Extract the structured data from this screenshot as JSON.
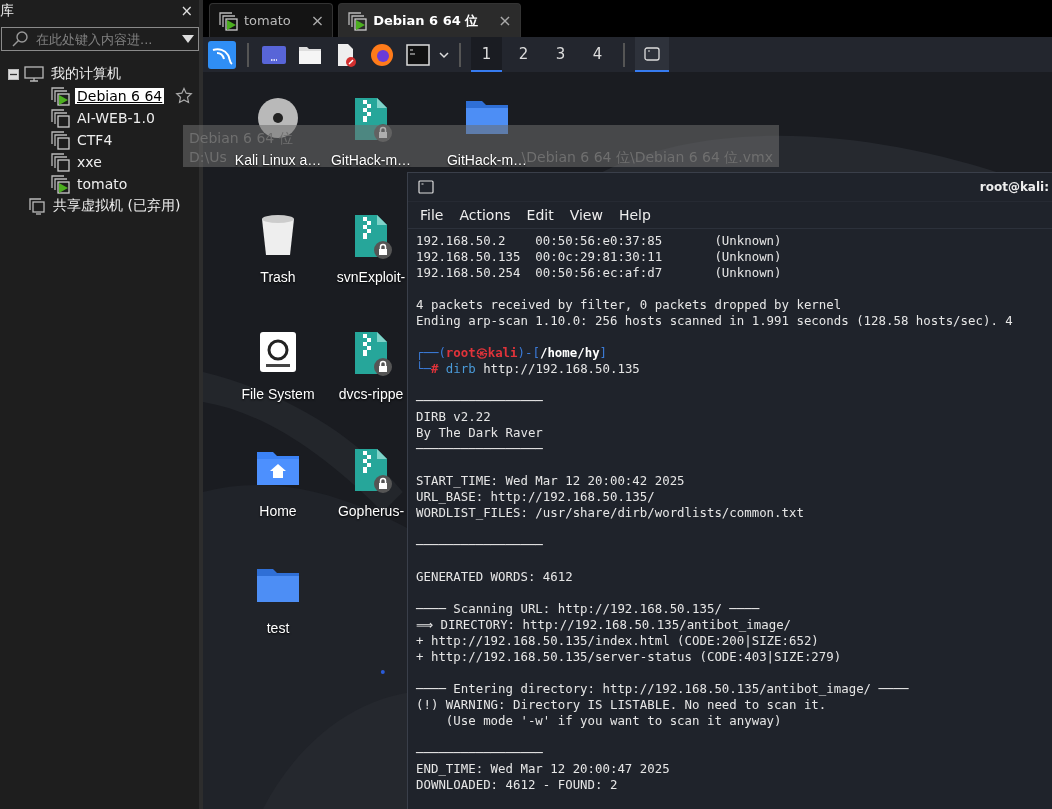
{
  "library": {
    "title": "库",
    "close": "×",
    "search": {
      "placeholder": "在此处键入内容进..."
    },
    "tree": [
      {
        "label": "我的计算机",
        "kind": "computer",
        "expanded": true,
        "children": [
          {
            "label": "Debian 6 64",
            "running": true,
            "selected": true
          },
          {
            "label": "AI-WEB-1.0",
            "running": false,
            "selected": false
          },
          {
            "label": "CTF4",
            "running": false,
            "selected": false
          },
          {
            "label": "xxe",
            "running": false,
            "selected": false
          },
          {
            "label": "tomato",
            "running": true,
            "selected": false
          }
        ]
      },
      {
        "label": "共享虚拟机 (已弃用)",
        "kind": "shared"
      }
    ]
  },
  "tabs": [
    {
      "label": "tomato",
      "close": "×",
      "selected": false
    },
    {
      "label": "Debian 6 64 位",
      "close": "×",
      "selected": true
    }
  ],
  "tooltip": {
    "title": "Debian 6 64 位",
    "path_parts": [
      "D:\\Us",
      "\\Debian 6 64 位\\Debian 6 64 位.vmx"
    ]
  },
  "panel": {
    "workspaces": [
      {
        "label": "1",
        "selected": true
      },
      {
        "label": "2",
        "selected": false
      },
      {
        "label": "3",
        "selected": false
      },
      {
        "label": "4",
        "selected": false
      }
    ]
  },
  "desktop_rows": [
    {
      "icons": [
        {
          "label": "Kali Linux a…",
          "kind": "disc"
        },
        {
          "label": "GitHack-m…",
          "kind": "archive"
        },
        {
          "label": "GitHack-m…",
          "kind": "folder"
        }
      ]
    },
    {
      "icons": [
        {
          "label": "Trash",
          "kind": "trash"
        },
        {
          "label": "svnExploit-",
          "kind": "archive"
        }
      ]
    },
    {
      "icons": [
        {
          "label": "File System",
          "kind": "drive"
        },
        {
          "label": "dvcs-rippe",
          "kind": "archive"
        }
      ]
    },
    {
      "icons": [
        {
          "label": "Home",
          "kind": "home"
        },
        {
          "label": "Gopherus-",
          "kind": "archive"
        }
      ]
    },
    {
      "icons": [
        {
          "label": "test",
          "kind": "folder"
        }
      ]
    }
  ],
  "terminal": {
    "title": "root@kali:",
    "menu": [
      "File",
      "Actions",
      "Edit",
      "View",
      "Help"
    ],
    "lines": [
      {
        "kind": "output",
        "text": "192.168.50.2    00:50:56:e0:37:85       (Unknown)"
      },
      {
        "kind": "output",
        "text": "192.168.50.135  00:0c:29:81:30:11       (Unknown)"
      },
      {
        "kind": "output",
        "text": "192.168.50.254  00:50:56:ec:af:d7       (Unknown)"
      },
      {
        "kind": "blank"
      },
      {
        "kind": "output",
        "text": "4 packets received by filter, 0 packets dropped by kernel"
      },
      {
        "kind": "output",
        "text": "Ending arp-scan 1.10.0: 256 hosts scanned in 1.991 seconds (128.58 hosts/sec). 4"
      },
      {
        "kind": "blank"
      },
      {
        "kind": "prompt",
        "parts": [
          "┌──(",
          "root㉿kali",
          ")-[",
          "/home/hy",
          "]"
        ]
      },
      {
        "kind": "command",
        "parts": [
          "└─",
          "#",
          " dirb",
          " http://192.168.50.135"
        ]
      },
      {
        "kind": "blank"
      },
      {
        "kind": "output",
        "text": "─────────────────"
      },
      {
        "kind": "output",
        "text": "DIRB v2.22"
      },
      {
        "kind": "output",
        "text": "By The Dark Raver"
      },
      {
        "kind": "output",
        "text": "─────────────────"
      },
      {
        "kind": "blank"
      },
      {
        "kind": "output",
        "text": "START_TIME: Wed Mar 12 20:00:42 2025"
      },
      {
        "kind": "output",
        "text": "URL_BASE: http://192.168.50.135/"
      },
      {
        "kind": "output",
        "text": "WORDLIST_FILES: /usr/share/dirb/wordlists/common.txt"
      },
      {
        "kind": "blank"
      },
      {
        "kind": "output",
        "text": "─────────────────"
      },
      {
        "kind": "blank"
      },
      {
        "kind": "output",
        "text": "GENERATED WORDS: 4612"
      },
      {
        "kind": "blank"
      },
      {
        "kind": "output",
        "text": "──── Scanning URL: http://192.168.50.135/ ────"
      },
      {
        "kind": "output",
        "text": "⟹ DIRECTORY: http://192.168.50.135/antibot_image/"
      },
      {
        "kind": "output",
        "text": "+ http://192.168.50.135/index.html (CODE:200|SIZE:652)"
      },
      {
        "kind": "output",
        "text": "+ http://192.168.50.135/server-status (CODE:403|SIZE:279)"
      },
      {
        "kind": "blank"
      },
      {
        "kind": "output",
        "text": "──── Entering directory: http://192.168.50.135/antibot_image/ ────"
      },
      {
        "kind": "output",
        "text": "(!) WARNING: Directory IS LISTABLE. No need to scan it."
      },
      {
        "kind": "output",
        "text": "    (Use mode '-w' if you want to scan it anyway)"
      },
      {
        "kind": "blank"
      },
      {
        "kind": "output",
        "text": "─────────────────"
      },
      {
        "kind": "output",
        "text": "END_TIME: Wed Mar 12 20:00:47 2025"
      },
      {
        "kind": "output",
        "text": "DOWNLOADED: 4612 - FOUND: 2"
      }
    ]
  }
}
